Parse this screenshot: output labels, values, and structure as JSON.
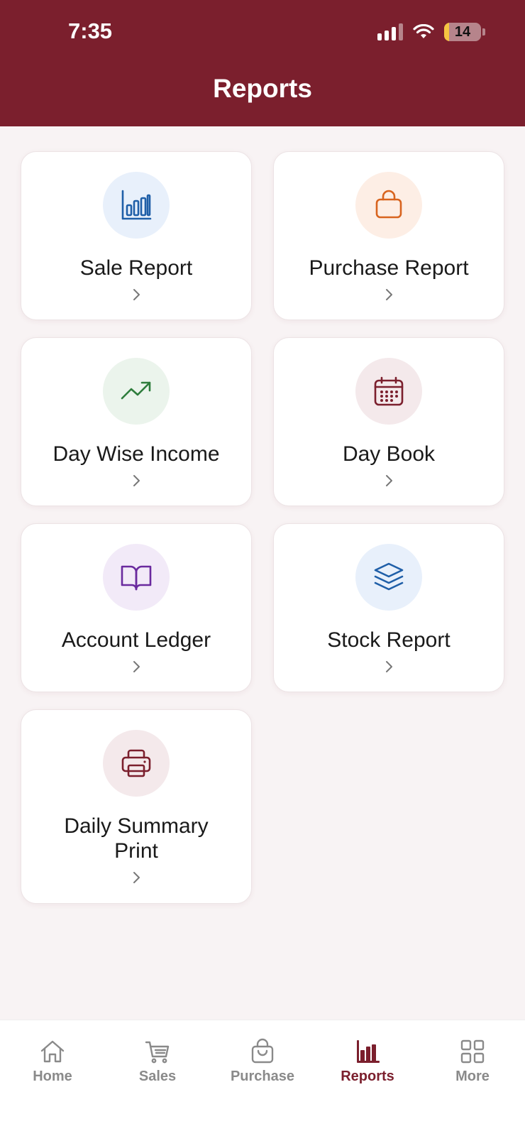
{
  "status_bar": {
    "time": "7:35",
    "battery_percent": "14",
    "battery_level": 0.14,
    "signal_icon": "cellular-signal-icon",
    "wifi_icon": "wifi-icon"
  },
  "header": {
    "title": "Reports",
    "background": "#7b1f2d"
  },
  "reports": [
    {
      "label": "Sale Report",
      "icon": "bar-chart-icon",
      "icon_color": "#1f5fa8",
      "circle_color": "#e8f0fb"
    },
    {
      "label": "Purchase Report",
      "icon": "shopping-bag-icon",
      "icon_color": "#d8641f",
      "circle_color": "#fdeee5"
    },
    {
      "label": "Day Wise Income",
      "icon": "trending-up-icon",
      "icon_color": "#2e7d3c",
      "circle_color": "#ebf4ec"
    },
    {
      "label": "Day Book",
      "icon": "calendar-icon",
      "icon_color": "#7b1f2d",
      "circle_color": "#f4e9eb"
    },
    {
      "label": "Account Ledger",
      "icon": "open-book-icon",
      "icon_color": "#6a2a9e",
      "circle_color": "#f2eaf8"
    },
    {
      "label": "Stock Report",
      "icon": "layers-icon",
      "icon_color": "#1f5fa8",
      "circle_color": "#e8f0fb"
    },
    {
      "label": "Daily Summary Print",
      "icon": "printer-icon",
      "icon_color": "#7b1f2d",
      "circle_color": "#f4e9eb"
    }
  ],
  "tabbar": {
    "tabs": [
      {
        "label": "Home",
        "icon": "home-icon",
        "active": false
      },
      {
        "label": "Sales",
        "icon": "cart-icon",
        "active": false
      },
      {
        "label": "Purchase",
        "icon": "shopping-bag-icon",
        "active": false
      },
      {
        "label": "Reports",
        "icon": "bar-chart-icon",
        "active": true
      },
      {
        "label": "More",
        "icon": "grid-icon",
        "active": false
      }
    ],
    "active_color": "#7b1f2d",
    "inactive_color": "#8a8a8a"
  }
}
